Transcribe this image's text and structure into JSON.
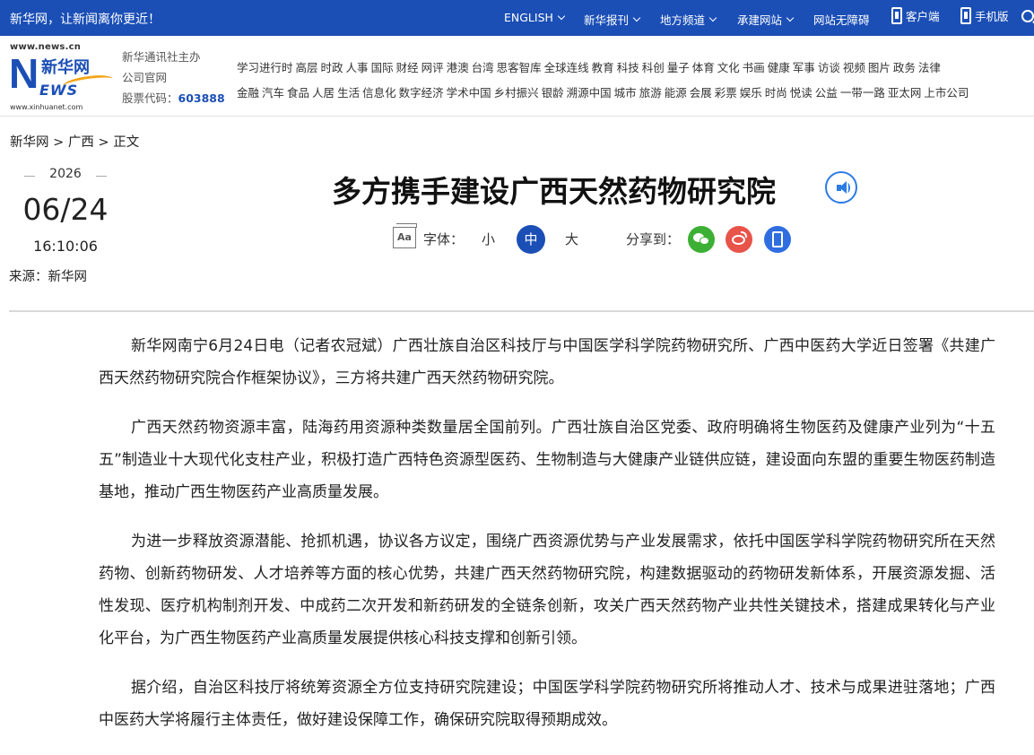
{
  "topbar": {
    "slogan": "新华网，让新闻离你更近！",
    "nav": [
      {
        "label": "ENGLISH",
        "has_dropdown": true
      },
      {
        "label": "新华报刊",
        "has_dropdown": true
      },
      {
        "label": "地方频道",
        "has_dropdown": true
      },
      {
        "label": "承建网站",
        "has_dropdown": true
      },
      {
        "label": "网站无障碍",
        "has_dropdown": false
      },
      {
        "label": "客户端",
        "icon": "phone-icon"
      },
      {
        "label": "手机版",
        "icon": "phone-icon"
      }
    ],
    "search_icon": "search-icon",
    "bg_color": "#1b4fb6"
  },
  "header": {
    "logo": {
      "url_top": "www.news.cn",
      "letter_n": "N",
      "name_cn": "新华网",
      "letters_ews": "EWS",
      "url_bottom": "www.xinhuanet.com"
    },
    "org_line1": "新华通讯社主办",
    "org_line2": "公司官网",
    "stock_label": "股票代码：",
    "stock_code": "603888",
    "channels_row1": [
      "学习进行时",
      "高层",
      "时政",
      "人事",
      "国际",
      "财经",
      "网评",
      "港澳",
      "台湾",
      "思客智库",
      "全球连线",
      "教育",
      "科技",
      "科创",
      "量子",
      "体育",
      "文化",
      "书画",
      "健康",
      "军事",
      "访谈",
      "视频",
      "图片",
      "政务",
      "法律"
    ],
    "channels_row2": [
      "金融",
      "汽车",
      "食品",
      "人居",
      "生活",
      "信息化",
      "数字经济",
      "学术中国",
      "乡村振兴",
      "银龄",
      "溯源中国",
      "城市",
      "旅游",
      "能源",
      "会展",
      "彩票",
      "娱乐",
      "时尚",
      "悦读",
      "公益",
      "一带一路",
      "亚太网",
      "上市公司"
    ]
  },
  "breadcrumb": {
    "home": "新华网",
    "sep": ">",
    "section": "广西",
    "current": "正文"
  },
  "meta": {
    "year": "2026",
    "monthday": "06/24",
    "time": "16:10:06",
    "source": "来源：新华网"
  },
  "article": {
    "title": "多方携手建设广西天然药物研究院",
    "font_label": "字体：",
    "size_small": "小",
    "size_mid": "中",
    "size_large": "大",
    "font_icon_text": "Aa",
    "share_label": "分享到：",
    "paragraphs": [
      "新华网南宁6月24日电（记者农冠斌）广西壮族自治区科技厅与中国医学科学院药物研究所、广西中医药大学近日签署《共建广西天然药物研究院合作框架协议》，三方将共建广西天然药物研究院。",
      "广西天然药物资源丰富，陆海药用资源种类数量居全国前列。广西壮族自治区党委、政府明确将生物医药及健康产业列为“十五五”制造业十大现代化支柱产业，积极打造广西特色资源型医药、生物制造与大健康产业链供应链，建设面向东盟的重要生物医药制造基地，推动广西生物医药产业高质量发展。",
      "为进一步释放资源潜能、抢抓机遇，协议各方议定，围绕广西资源优势与产业发展需求，依托中国医学科学院药物研究所在天然药物、创新药物研发、人才培养等方面的核心优势，共建广西天然药物研究院，构建数据驱动的药物研发新体系，开展资源发掘、活性发现、医疗机构制剂开发、中成药二次开发和新药研发的全链条创新，攻关广西天然药物产业共性关键技术，搭建成果转化与产业化平台，为广西生物医药产业高质量发展提供核心科技支撑和创新引领。",
      "据介绍，自治区科技厅将统筹资源全方位支持研究院建设；中国医学科学院药物研究所将推动人才、技术与成果进驻落地；广西中医药大学将履行主体责任，做好建设保障工作，确保研究院取得预期成效。"
    ]
  },
  "colors": {
    "brand_blue": "#1b4fb6",
    "wechat_green": "#3cb034",
    "weibo_red": "#e8534a",
    "app_blue": "#2f6ee0",
    "speaker_blue": "#2c7be5"
  }
}
